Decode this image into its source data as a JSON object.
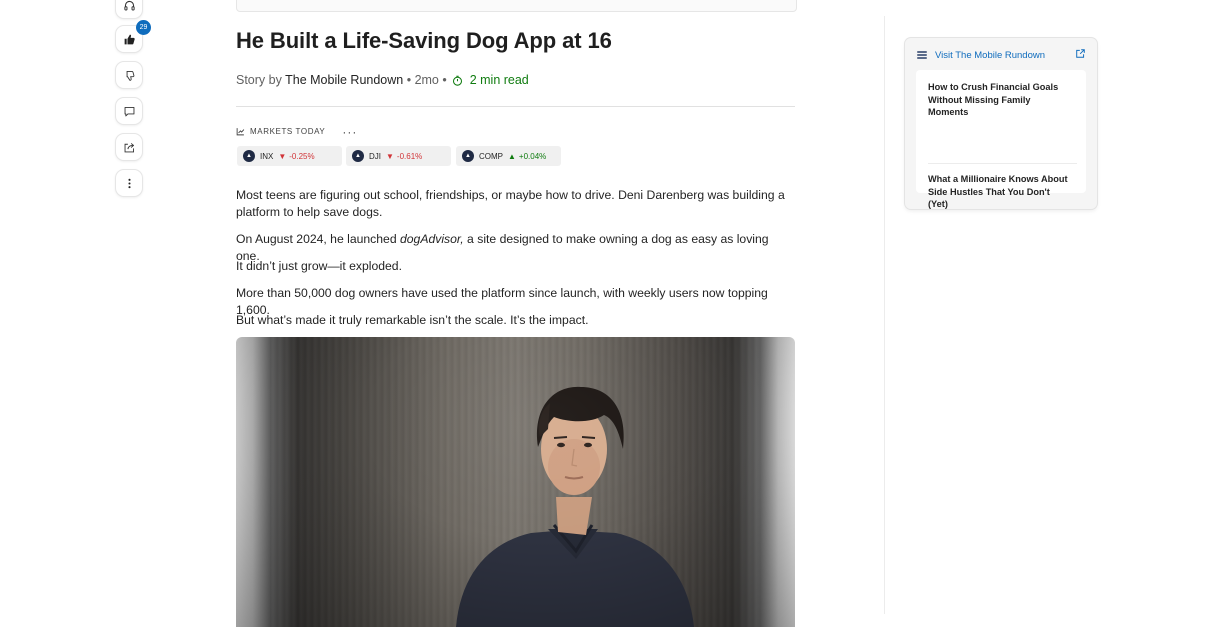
{
  "rail": {
    "like_count": "29"
  },
  "article": {
    "title": "He Built a Life-Saving Dog App at 16",
    "byline_prefix": "Story by",
    "provider": "The Mobile Rundown",
    "age": "• 2mo •",
    "read_time": "2 min read"
  },
  "markets": {
    "label": "MARKETS TODAY",
    "more": "···",
    "tickers": [
      {
        "symbol": "INX",
        "direction": "down",
        "arrow": "▼",
        "change": "-0.25%"
      },
      {
        "symbol": "DJI",
        "direction": "down",
        "arrow": "▼",
        "change": "-0.61%"
      },
      {
        "symbol": "COMP",
        "direction": "up",
        "arrow": "▲",
        "change": "+0.04%"
      }
    ]
  },
  "body": {
    "p1": "Most teens are figuring out school, friendships, or maybe how to drive. Deni Darenberg was building a platform to help save dogs.",
    "p2_before": "On August 2024, he launched ",
    "p2_em": "dogAdvisor,",
    "p2_after": " a site designed to make owning a dog as easy as loving one.",
    "p3": "It didn’t just grow—it exploded.",
    "p4": "More than 50,000 dog owners have used the platform since launch, with weekly users now topping 1,600.",
    "p5": "But what’s made it truly remarkable isn’t the scale. It’s the impact."
  },
  "sidebar": {
    "visit_label": "Visit The Mobile Rundown",
    "stories": [
      "How to Crush Financial Goals Without Missing Family Moments",
      "What a Millionaire Knows About Side Hustles That You Don't (Yet)"
    ]
  },
  "colors": {
    "accent_blue": "#0f6cbd",
    "down_red": "#d13438",
    "up_green": "#107c10"
  }
}
